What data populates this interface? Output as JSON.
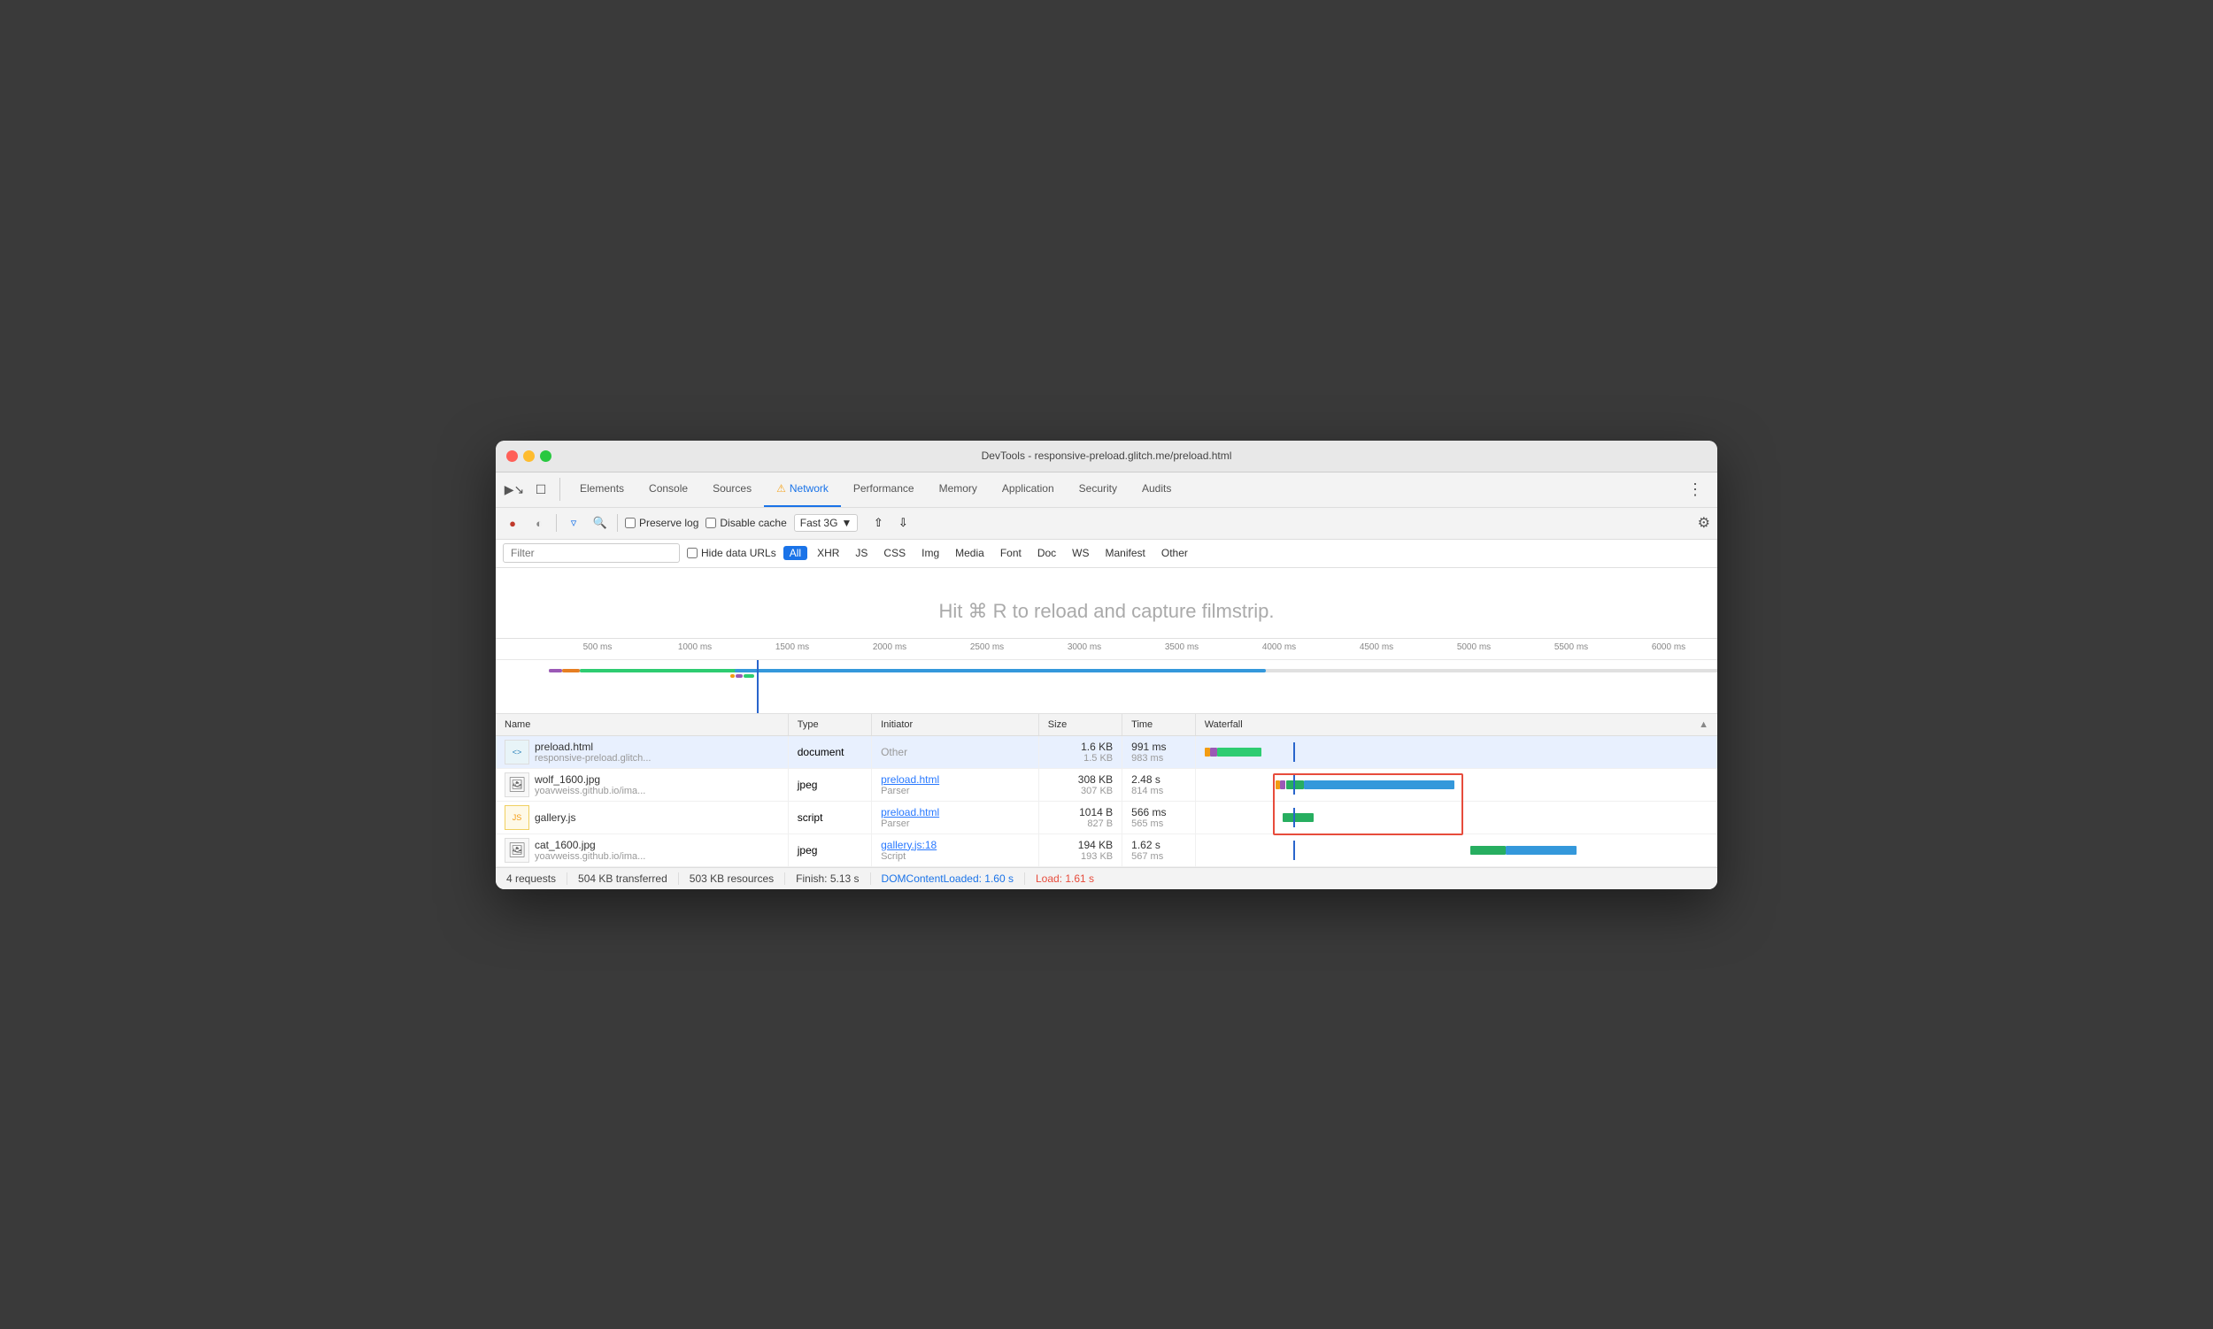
{
  "window": {
    "title": "DevTools - responsive-preload.glitch.me/preload.html"
  },
  "tabs": {
    "items": [
      {
        "label": "Elements",
        "active": false
      },
      {
        "label": "Console",
        "active": false
      },
      {
        "label": "Sources",
        "active": false
      },
      {
        "label": "Network",
        "active": true,
        "warning": true
      },
      {
        "label": "Performance",
        "active": false
      },
      {
        "label": "Memory",
        "active": false
      },
      {
        "label": "Application",
        "active": false
      },
      {
        "label": "Security",
        "active": false
      },
      {
        "label": "Audits",
        "active": false
      }
    ]
  },
  "controls": {
    "preserve_log": "Preserve log",
    "disable_cache": "Disable cache",
    "throttle": "Fast 3G",
    "filter_placeholder": "Filter"
  },
  "filter_tags": {
    "items": [
      {
        "label": "All",
        "active": true
      },
      {
        "label": "XHR"
      },
      {
        "label": "JS"
      },
      {
        "label": "CSS"
      },
      {
        "label": "Img"
      },
      {
        "label": "Media"
      },
      {
        "label": "Font"
      },
      {
        "label": "Doc"
      },
      {
        "label": "WS"
      },
      {
        "label": "Manifest"
      },
      {
        "label": "Other"
      }
    ],
    "hide_data_urls": "Hide data URLs"
  },
  "filmstrip": {
    "hint": "Hit ⌘ R to reload and capture filmstrip."
  },
  "timeline": {
    "marks": [
      "500 ms",
      "1000 ms",
      "1500 ms",
      "2000 ms",
      "2500 ms",
      "3000 ms",
      "3500 ms",
      "4000 ms",
      "4500 ms",
      "5000 ms",
      "5500 ms",
      "6000 ms"
    ]
  },
  "table": {
    "headers": [
      "Name",
      "Type",
      "Initiator",
      "Size",
      "Time",
      "Waterfall"
    ],
    "rows": [
      {
        "icon_type": "html",
        "icon_label": "<>",
        "name": "preload.html",
        "url": "responsive-preload.glitch...",
        "type": "document",
        "initiator": "Other",
        "size_main": "1.6 KB",
        "size_sub": "1.5 KB",
        "time_main": "991 ms",
        "time_sub": "983 ms",
        "selected": true
      },
      {
        "icon_type": "img",
        "icon_label": "🖼",
        "name": "wolf_1600.jpg",
        "url": "yoavweiss.github.io/ima...",
        "type": "jpeg",
        "initiator_link": "preload.html",
        "initiator_sub": "Parser",
        "size_main": "308 KB",
        "size_sub": "307 KB",
        "time_main": "2.48 s",
        "time_sub": "814 ms",
        "selected": false
      },
      {
        "icon_type": "js",
        "icon_label": "JS",
        "name": "gallery.js",
        "url": "",
        "type": "script",
        "initiator_link": "preload.html",
        "initiator_sub": "Parser",
        "size_main": "1014 B",
        "size_sub": "827 B",
        "time_main": "566 ms",
        "time_sub": "565 ms",
        "selected": false
      },
      {
        "icon_type": "img",
        "icon_label": "🖼",
        "name": "cat_1600.jpg",
        "url": "yoavweiss.github.io/ima...",
        "type": "jpeg",
        "initiator_link": "gallery.js:18",
        "initiator_sub": "Script",
        "size_main": "194 KB",
        "size_sub": "193 KB",
        "time_main": "1.62 s",
        "time_sub": "567 ms",
        "selected": false
      }
    ]
  },
  "status_bar": {
    "requests": "4 requests",
    "transferred": "504 KB transferred",
    "resources": "503 KB resources",
    "finish": "Finish: 5.13 s",
    "dom_loaded": "DOMContentLoaded: 1.60 s",
    "load": "Load: 1.61 s"
  }
}
